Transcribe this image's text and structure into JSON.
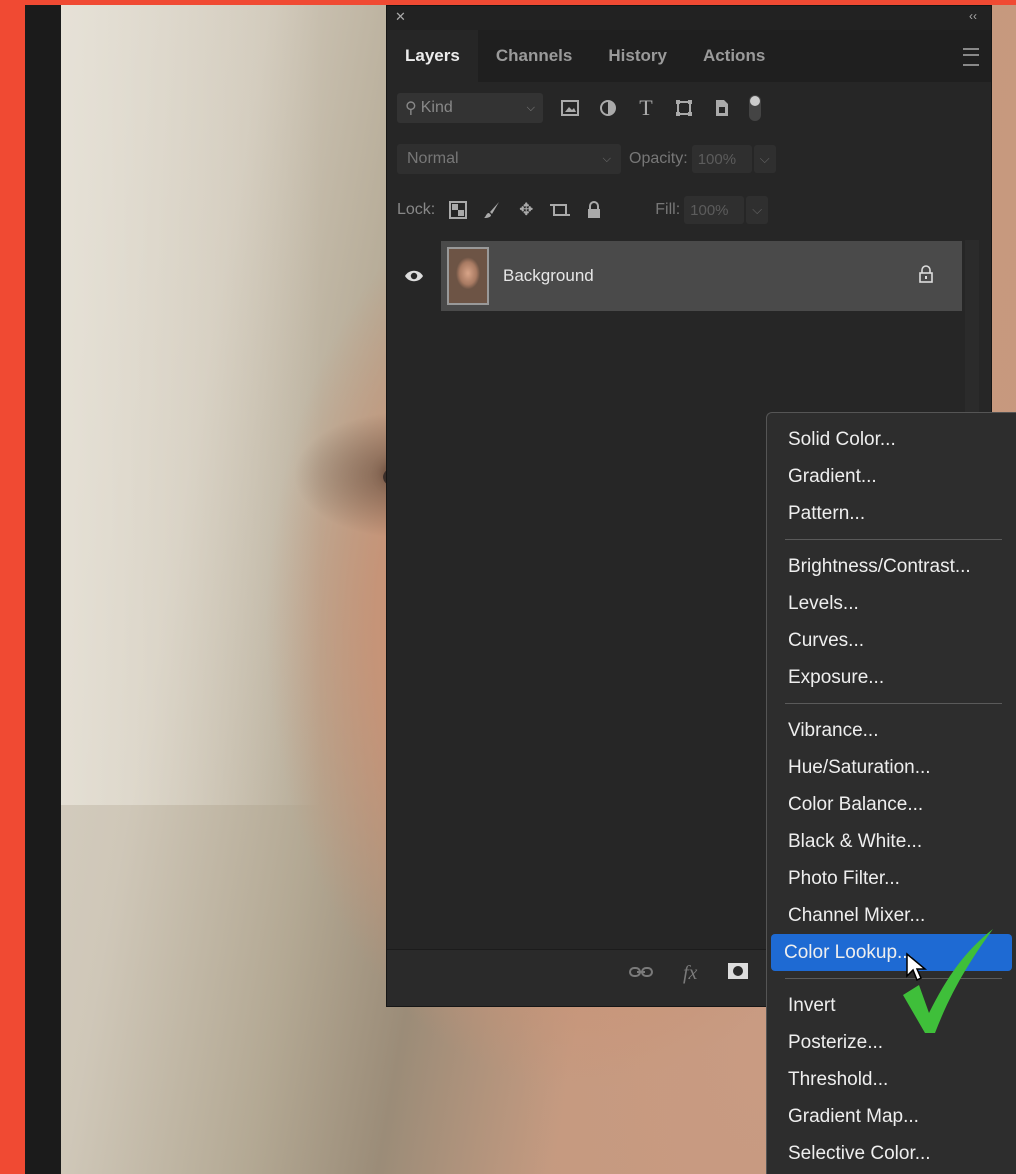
{
  "panel": {
    "close_icon": "close-icon",
    "collapse_glyph": "‹‹",
    "tabs": [
      {
        "label": "Layers",
        "active": true
      },
      {
        "label": "Channels",
        "active": false
      },
      {
        "label": "History",
        "active": false
      },
      {
        "label": "Actions",
        "active": false
      }
    ],
    "filter": {
      "kind_label": "Kind"
    },
    "blend": {
      "mode": "Normal",
      "opacity_label": "Opacity:",
      "opacity_value": "100%"
    },
    "lock": {
      "label": "Lock:",
      "fill_label": "Fill:",
      "fill_value": "100%"
    },
    "layer": {
      "name": "Background",
      "visible": true,
      "locked": true
    }
  },
  "menu": {
    "groups": [
      [
        "Solid Color...",
        "Gradient...",
        "Pattern..."
      ],
      [
        "Brightness/Contrast...",
        "Levels...",
        "Curves...",
        "Exposure..."
      ],
      [
        "Vibrance...",
        "Hue/Saturation...",
        "Color Balance...",
        "Black & White...",
        "Photo Filter...",
        "Channel Mixer...",
        "Color Lookup..."
      ],
      [
        "Invert",
        "Posterize...",
        "Threshold...",
        "Gradient Map...",
        "Selective Color..."
      ]
    ],
    "highlighted_item": "Color Lookup...",
    "highlight_color": "#1e6ad3"
  },
  "colors": {
    "frame_accent": "#f04a33",
    "checkmark": "#3fbf3a"
  }
}
